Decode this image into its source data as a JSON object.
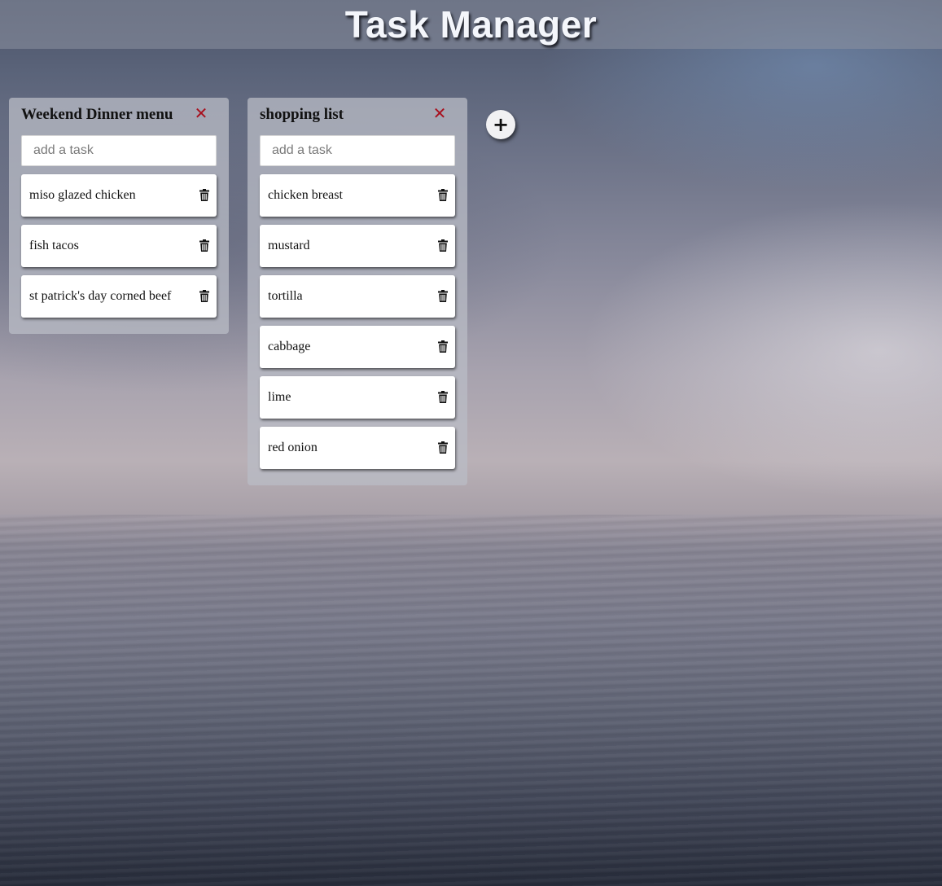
{
  "header": {
    "title": "Task Manager"
  },
  "lists": [
    {
      "title": "Weekend Dinner menu",
      "close_icon": "close-icon",
      "close_glyph": "✕",
      "input_placeholder": "add a task",
      "tasks": [
        {
          "label": "miso glazed chicken"
        },
        {
          "label": "fish tacos"
        },
        {
          "label": "st patrick's day corned beef"
        }
      ]
    },
    {
      "title": "shopping list",
      "close_icon": "close-icon",
      "close_glyph": "✕",
      "input_placeholder": "add a task",
      "tasks": [
        {
          "label": "chicken breast"
        },
        {
          "label": "mustard"
        },
        {
          "label": "tortilla"
        },
        {
          "label": "cabbage"
        },
        {
          "label": "lime"
        },
        {
          "label": "red onion"
        }
      ]
    }
  ],
  "add_list_button": {
    "glyph": "+",
    "icon": "plus-icon"
  },
  "colors": {
    "close_icon": "#a8101e",
    "header_text": "#f4f6fb"
  }
}
